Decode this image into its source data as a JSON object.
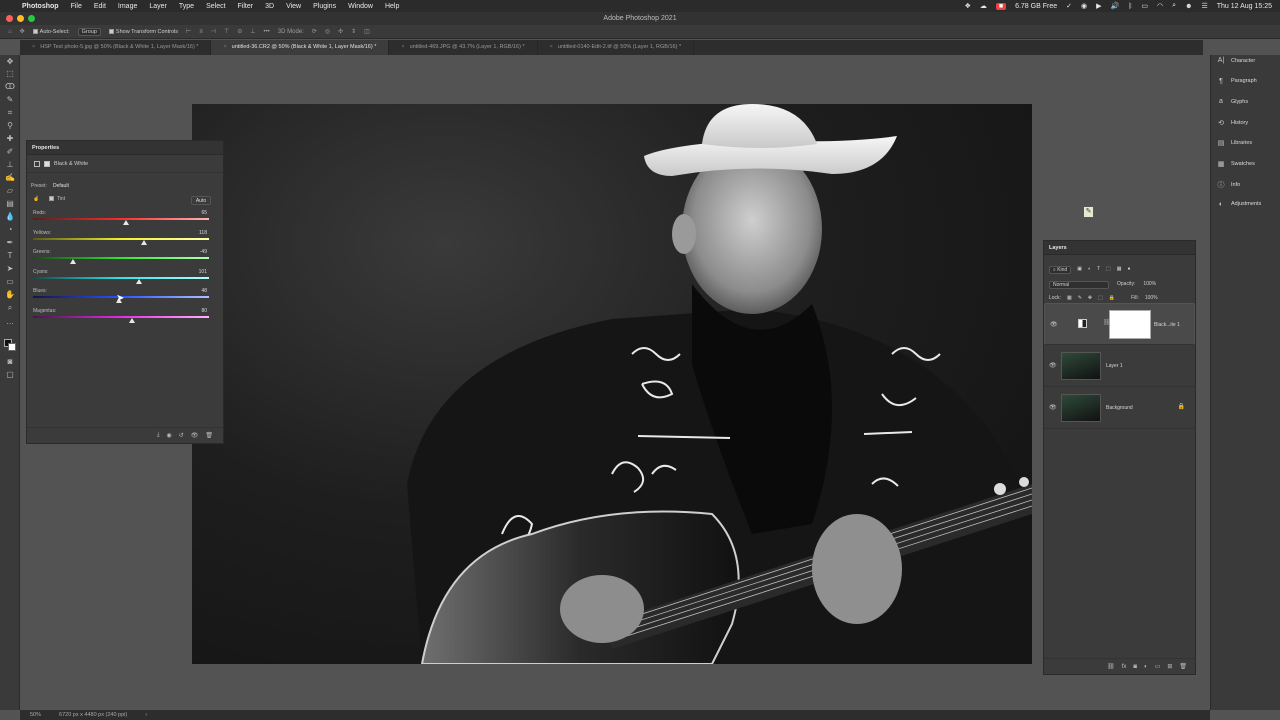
{
  "menubar": {
    "app_name": "Photoshop",
    "items": [
      "File",
      "Edit",
      "Image",
      "Layer",
      "Type",
      "Select",
      "Filter",
      "3D",
      "View",
      "Plugins",
      "Window",
      "Help"
    ],
    "free_space": "6.78 GB Free",
    "datetime": "Thu 12 Aug  15:25"
  },
  "titlebar": {
    "title": "Adobe Photoshop 2021"
  },
  "options": {
    "auto_select": "Auto-Select:",
    "group": "Group",
    "transform": "Show Transform Controls",
    "mode3d": "3D Mode:"
  },
  "tabs": [
    {
      "label": "HSP Test photo-5.jpg @ 50% (Black & White 1, Layer Mask/16) *",
      "active": false
    },
    {
      "label": "untitled-36.CR2 @ 50% (Black & White 1, Layer Mask/16) *",
      "active": true
    },
    {
      "label": "untitled-469.JPG @ 43.7% (Layer 1, RGB/16) *",
      "active": false
    },
    {
      "label": "untitled-0140-Edit-2.tif @ 50% (Layer 1, RGB/16) *",
      "active": false
    }
  ],
  "properties": {
    "title": "Properties",
    "adjustment": "Black & White",
    "preset_label": "Preset:",
    "preset_value": "Default",
    "tint_label": "Tint",
    "auto_label": "Auto",
    "sliders": [
      {
        "label": "Reds:",
        "value": "65",
        "pos": 0.53,
        "gradient": "linear-gradient(90deg,#5a1e1e,#ff2a2a,#ffb3b3)"
      },
      {
        "label": "Yellows:",
        "value": "118",
        "pos": 0.63,
        "gradient": "linear-gradient(90deg,#5a5a14,#f2f22a,#ffffb0)"
      },
      {
        "label": "Greens:",
        "value": "-49",
        "pos": 0.23,
        "gradient": "linear-gradient(90deg,#1b4a1b,#2ee62e,#b4ffb4)"
      },
      {
        "label": "Cyans:",
        "value": "101",
        "pos": 0.6,
        "gradient": "linear-gradient(90deg,#144a4a,#2ae6e6,#b0ffff)"
      },
      {
        "label": "Blues:",
        "value": "48",
        "pos": 0.49,
        "gradient": "linear-gradient(90deg,#14144a,#2a52ff,#b0c0ff)"
      },
      {
        "label": "Magentas:",
        "value": "80",
        "pos": 0.56,
        "gradient": "linear-gradient(90deg,#4a144a,#e62ae6,#ffb0ff)"
      }
    ]
  },
  "dock": {
    "items": [
      {
        "label": "Character",
        "icon": "A|"
      },
      {
        "label": "Paragraph",
        "icon": "¶"
      },
      {
        "label": "Glyphs",
        "icon": "a"
      },
      {
        "label": "History",
        "icon": "⟲"
      },
      {
        "label": "Libraries",
        "icon": "▤"
      },
      {
        "label": "Swatches",
        "icon": "▦"
      },
      {
        "label": "Info",
        "icon": "ⓘ"
      },
      {
        "label": "Adjustments",
        "icon": "◐"
      }
    ]
  },
  "layers": {
    "title": "Layers",
    "kind": "Kind",
    "blend": "Normal",
    "opacity_label": "Opacity:",
    "opacity": "100%",
    "lock_label": "Lock:",
    "fill_label": "Fill:",
    "fill": "100%",
    "items": [
      {
        "name": "Black...ite 1",
        "selected": true
      },
      {
        "name": "Layer 1",
        "selected": false
      },
      {
        "name": "Background",
        "selected": false
      }
    ]
  },
  "status": {
    "zoom": "50%",
    "doc_info": "6720 px x 4480 px (240 ppi)"
  },
  "colors": {
    "app_bg": "#535353",
    "panel_bg": "#3b3b3b"
  }
}
